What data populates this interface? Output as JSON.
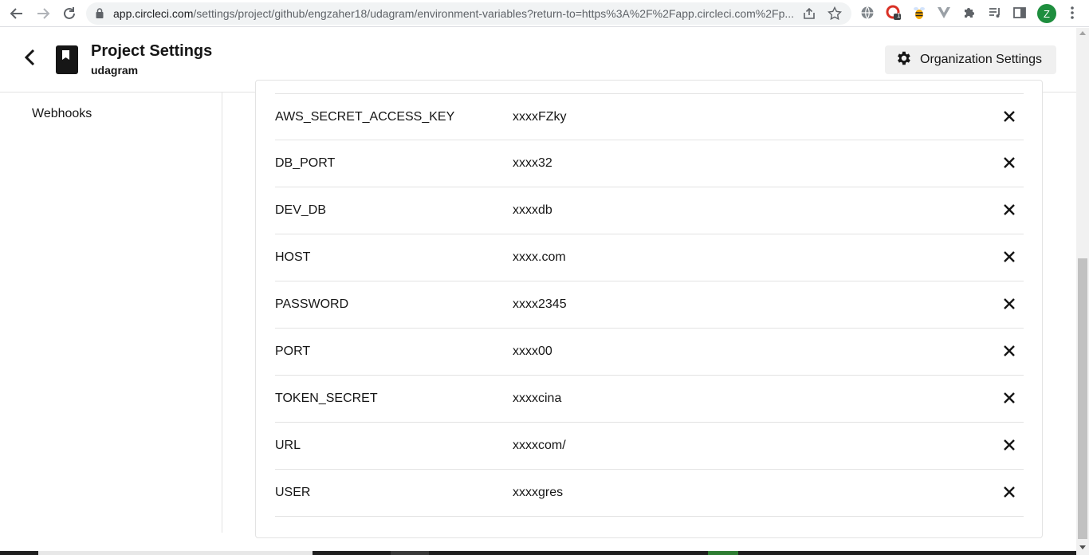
{
  "browser": {
    "url_host": "app.circleci.com",
    "url_path": "/settings/project/github/engzaher18/udagram/environment-variables?return-to=https%3A%2F%2Fapp.circleci.com%2Fp...",
    "avatar_letter": "Z",
    "extension_badge": "1"
  },
  "header": {
    "title": "Project Settings",
    "project_name": "udagram",
    "org_settings_label": "Organization Settings"
  },
  "sidebar": {
    "items": [
      {
        "label": "Webhooks"
      }
    ]
  },
  "env_vars": [
    {
      "name": "AWS_SECRET_ACCESS_KEY",
      "value": "xxxxFZky"
    },
    {
      "name": "DB_PORT",
      "value": "xxxx32"
    },
    {
      "name": "DEV_DB",
      "value": "xxxxdb"
    },
    {
      "name": "HOST",
      "value": "xxxx.com"
    },
    {
      "name": "PASSWORD",
      "value": "xxxx2345"
    },
    {
      "name": "PORT",
      "value": "xxxx00"
    },
    {
      "name": "TOKEN_SECRET",
      "value": "xxxxcina"
    },
    {
      "name": "URL",
      "value": "xxxxcom/"
    },
    {
      "name": "USER",
      "value": "xxxxgres"
    }
  ],
  "colors": {
    "text": "#161616",
    "border": "#e3e3e3",
    "button_bg": "#f0f0f0",
    "avatar": "#1e8e3e"
  },
  "icons": {
    "back": "chevron-left-icon",
    "project": "bookmark-icon",
    "org_settings": "gear-icon",
    "delete": "close-icon"
  }
}
